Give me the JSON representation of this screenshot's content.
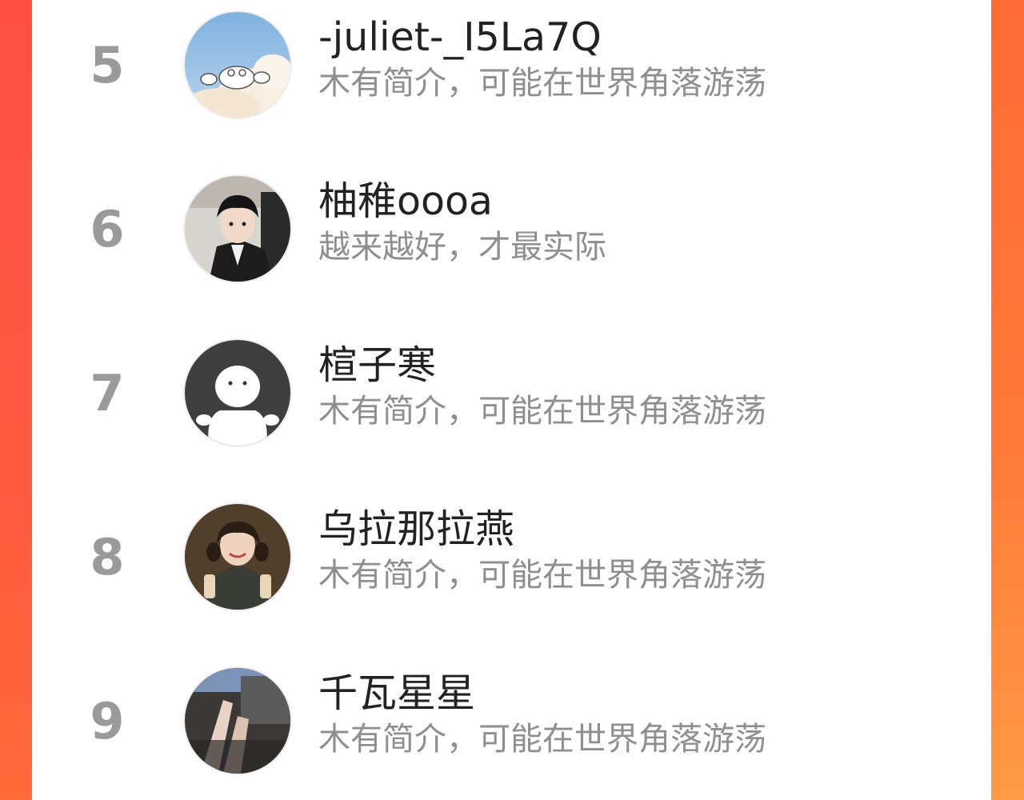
{
  "colors": {
    "accent_left": "#ff4f45",
    "accent_right": "#ff7a38",
    "rank_text": "#9a9a9a",
    "name_text": "#222222",
    "bio_text": "#8f8f8f"
  },
  "ranking": {
    "items": [
      {
        "rank": "5",
        "name": "-juliet-_I5La7Q",
        "bio": "木有简介，可能在世界角落游荡",
        "avatar": "cloud-frog-avatar"
      },
      {
        "rank": "6",
        "name": "柚稚oooa",
        "bio": "越来越好，才最实际",
        "avatar": "young-man-in-suit-avatar"
      },
      {
        "rank": "7",
        "name": "楦子寒",
        "bio": "木有简介，可能在世界角落游荡",
        "avatar": "default-ghost-avatar"
      },
      {
        "rank": "8",
        "name": "乌拉那拉燕",
        "bio": "木有简介，可能在世界角落游荡",
        "avatar": "smiling-girl-avatar"
      },
      {
        "rank": "9",
        "name": "千瓦星星",
        "bio": "木有简介，可能在世界角落游荡",
        "avatar": "legs-photo-avatar"
      }
    ]
  }
}
